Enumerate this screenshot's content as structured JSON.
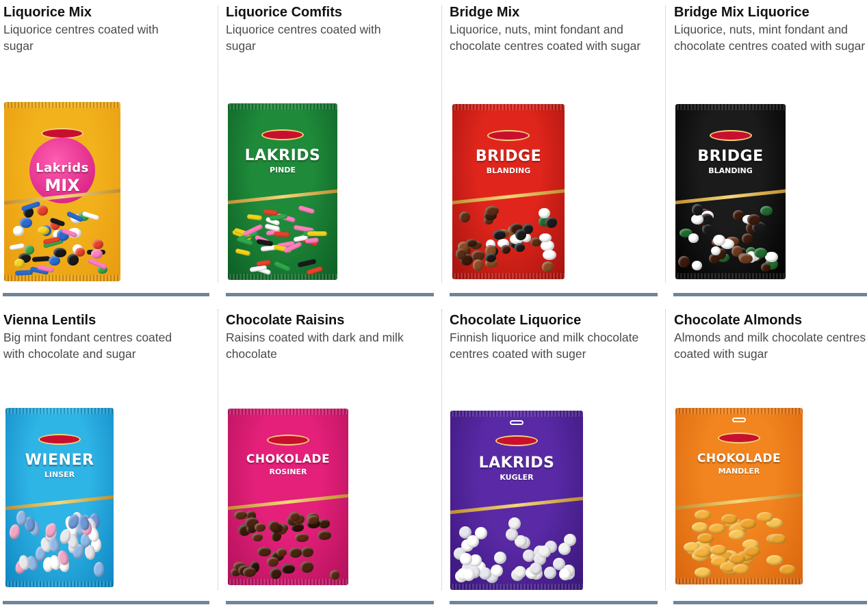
{
  "products": [
    {
      "title": "Liquorice Mix",
      "desc": "Liquorice centres coated with sugar",
      "bag": {
        "color": "#f2b21c",
        "color2": "#e89a10",
        "name1": "Lakrids",
        "name2": "MIX",
        "style": "mix"
      }
    },
    {
      "title": "Liquorice Comfits",
      "desc": "Liquorice centres coated with sugar",
      "bag": {
        "color": "#1f8a3a",
        "color2": "#0d5e24",
        "name1": "LAKRIDS",
        "name2": "PINDE",
        "style": "sticks"
      }
    },
    {
      "title": "Bridge Mix",
      "desc": "Liquorice, nuts, mint fondant and chocolate centres coated with sugar",
      "bag": {
        "color": "#e0261c",
        "color2": "#a5130e",
        "name1": "BRIDGE",
        "name2": "BLANDING",
        "style": "bridge"
      }
    },
    {
      "title": "Bridge Mix Liquorice",
      "desc": "Liquorice, nuts, mint fondant and chocolate centres coated with sugar",
      "bag": {
        "color": "#1b1b1b",
        "color2": "#000000",
        "name1": "BRIDGE",
        "name2": "BLANDING",
        "style": "bridgeblack"
      }
    },
    {
      "title": "Vienna Lentils",
      "desc": "Big mint fondant centres coated with chocolate and sugar",
      "bag": {
        "color": "#2fb4e6",
        "color2": "#0f86c2",
        "name1": "WIENER",
        "name2": "LINSER",
        "style": "lentils"
      }
    },
    {
      "title": "Chocolate Raisins",
      "desc": "Raisins coated with dark and milk chocolate",
      "bag": {
        "color": "#e4207a",
        "color2": "#b1115a",
        "name1": "CHOKOLADE",
        "name2": "ROSINER",
        "style": "raisins"
      }
    },
    {
      "title": "Chocolate Liquorice",
      "desc": "Finnish liquorice and milk chocolate centres coated with suger",
      "bag": {
        "color": "#5a2aa6",
        "color2": "#3a167a",
        "name1": "LAKRIDS",
        "name2": "KUGLER",
        "style": "balls"
      }
    },
    {
      "title": "Chocolate Almonds",
      "desc": "Almonds and milk chocolate centres coated with sugar",
      "bag": {
        "color": "#f2851f",
        "color2": "#d9650e",
        "name1": "CHOKOLADE",
        "name2": "MANDLER",
        "style": "almonds"
      }
    }
  ],
  "colors": {
    "divider_bar": "#6f8499",
    "brand_logo": "#c8102e"
  }
}
